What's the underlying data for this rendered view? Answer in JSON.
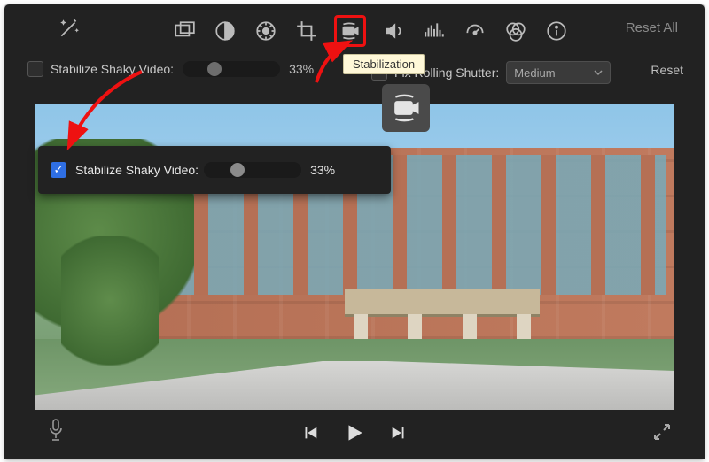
{
  "toolbar": {
    "reset_all_label": "Reset All",
    "tooltip": "Stabilization"
  },
  "options": {
    "stabilize_label": "Stabilize Shaky Video:",
    "stabilize_percent": "33%",
    "rolling_label": "Fix Rolling Shutter:",
    "rolling_value": "Medium",
    "reset_label": "Reset"
  },
  "callout": {
    "stabilize_label": "Stabilize Shaky Video:",
    "stabilize_percent": "33%"
  }
}
